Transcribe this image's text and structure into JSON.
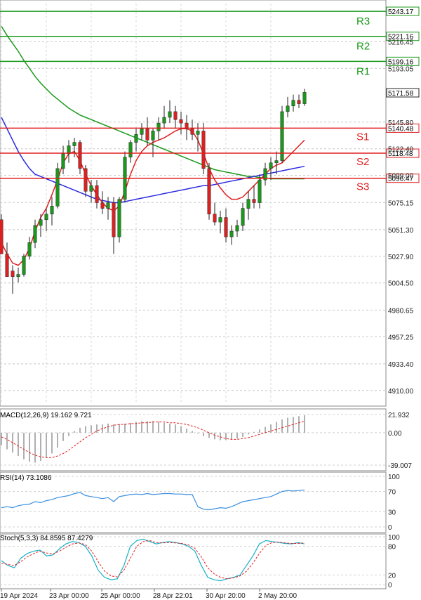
{
  "chart_data": {
    "type": "candlestick",
    "price_axis": {
      "ylim": [
        4900,
        5250
      ],
      "ticks": [
        "5216.45",
        "5193.05",
        "5145.80",
        "5122.40",
        "5099.00",
        "5075.15",
        "5051.30",
        "5027.90",
        "5004.50",
        "4980.65",
        "4957.25",
        "4933.40",
        "4910.00"
      ]
    },
    "time_axis": {
      "labels": [
        "19 Apr 2024",
        "23 Apr 00:00",
        "25 Apr 00:00",
        "28 Apr 22:01",
        "30 Apr 20:00",
        "2 May 20:00"
      ]
    },
    "levels": [
      {
        "name": "R3",
        "value": 5243.17,
        "label": "5243.17",
        "color": "#1a9a1a"
      },
      {
        "name": "R2",
        "value": 5221.16,
        "label": "5221.16",
        "color": "#1a9a1a"
      },
      {
        "name": "R1",
        "value": 5199.16,
        "label": "5199.16",
        "color": "#1a9a1a"
      },
      {
        "name": "S1",
        "value": 5140.48,
        "label": "5140.48",
        "color": "#e02020"
      },
      {
        "name": "S2",
        "value": 5118.48,
        "label": "5118.48",
        "color": "#e02020"
      },
      {
        "name": "S3",
        "value": 5096.47,
        "label": "5096.47",
        "color": "#e02020"
      }
    ],
    "last_price": {
      "value": 5171.58,
      "label": "5171.58"
    },
    "colors": {
      "up": "#1a9a1a",
      "down": "#e02020",
      "wick": "#222222",
      "ma_fast": "#e02020",
      "ma_mid": "#2a2ae0",
      "ma_slow": "#1a9a1a",
      "macd_hist": "#b0b0b0",
      "macd_signal": "#e02020",
      "rsi": "#3a8fe0",
      "stoch_main": "#18b0c8",
      "stoch_signal": "#e02020"
    },
    "candles": [
      [
        5060,
        5065,
        5040,
        5030
      ],
      [
        5030,
        5040,
        5015,
        5010
      ],
      [
        5015,
        5020,
        4995,
        5010
      ],
      [
        5010,
        5018,
        5005,
        5012
      ],
      [
        5012,
        5030,
        5010,
        5028
      ],
      [
        5028,
        5045,
        5025,
        5040
      ],
      [
        5040,
        5060,
        5035,
        5055
      ],
      [
        5055,
        5065,
        5045,
        5060
      ],
      [
        5060,
        5070,
        5050,
        5065
      ],
      [
        5065,
        5080,
        5055,
        5072
      ],
      [
        5072,
        5110,
        5070,
        5105
      ],
      [
        5105,
        5125,
        5100,
        5118
      ],
      [
        5118,
        5130,
        5110,
        5125
      ],
      [
        5125,
        5132,
        5115,
        5128
      ],
      [
        5128,
        5130,
        5100,
        5105
      ],
      [
        5105,
        5108,
        5080,
        5085
      ],
      [
        5085,
        5095,
        5075,
        5090
      ],
      [
        5090,
        5095,
        5070,
        5075
      ],
      [
        5075,
        5085,
        5065,
        5070
      ],
      [
        5070,
        5080,
        5060,
        5075
      ],
      [
        5075,
        5080,
        5030,
        5045
      ],
      [
        5045,
        5080,
        5040,
        5078
      ],
      [
        5078,
        5120,
        5075,
        5115
      ],
      [
        5115,
        5130,
        5110,
        5128
      ],
      [
        5128,
        5140,
        5120,
        5135
      ],
      [
        5135,
        5145,
        5130,
        5140
      ],
      [
        5140,
        5150,
        5125,
        5130
      ],
      [
        5130,
        5140,
        5115,
        5138
      ],
      [
        5138,
        5150,
        5130,
        5145
      ],
      [
        5145,
        5160,
        5140,
        5150
      ],
      [
        5150,
        5165,
        5145,
        5155
      ],
      [
        5155,
        5160,
        5140,
        5148
      ],
      [
        5148,
        5155,
        5135,
        5145
      ],
      [
        5145,
        5152,
        5130,
        5140
      ],
      [
        5140,
        5148,
        5130,
        5135
      ],
      [
        5135,
        5145,
        5120,
        5138
      ],
      [
        5138,
        5145,
        5100,
        5105
      ],
      [
        5105,
        5110,
        5060,
        5065
      ],
      [
        5065,
        5075,
        5055,
        5058
      ],
      [
        5058,
        5068,
        5048,
        5062
      ],
      [
        5062,
        5070,
        5040,
        5045
      ],
      [
        5045,
        5055,
        5038,
        5050
      ],
      [
        5050,
        5060,
        5045,
        5055
      ],
      [
        5055,
        5075,
        5050,
        5070
      ],
      [
        5070,
        5085,
        5060,
        5078
      ],
      [
        5078,
        5090,
        5070,
        5075
      ],
      [
        5075,
        5100,
        5070,
        5095
      ],
      [
        5095,
        5110,
        5090,
        5105
      ],
      [
        5105,
        5115,
        5095,
        5110
      ],
      [
        5110,
        5120,
        5100,
        5112
      ],
      [
        5112,
        5160,
        5110,
        5155
      ],
      [
        5155,
        5168,
        5150,
        5160
      ],
      [
        5160,
        5170,
        5155,
        5165
      ],
      [
        5165,
        5170,
        5158,
        5162
      ],
      [
        5162,
        5175,
        5160,
        5172
      ]
    ],
    "ma_fast": [
      5040,
      5030,
      5022,
      5020,
      5025,
      5035,
      5050,
      5062,
      5070,
      5082,
      5095,
      5110,
      5118,
      5120,
      5112,
      5100,
      5090,
      5082,
      5075,
      5070,
      5068,
      5072,
      5085,
      5100,
      5112,
      5120,
      5125,
      5128,
      5130,
      5132,
      5135,
      5138,
      5140,
      5140,
      5138,
      5130,
      5118,
      5105,
      5095,
      5088,
      5082,
      5078,
      5078,
      5080,
      5085,
      5090,
      5095,
      5100,
      5105,
      5108,
      5110,
      5115,
      5120,
      5125,
      5130
    ],
    "ma_mid": [
      5150,
      5140,
      5130,
      5120,
      5112,
      5105,
      5100,
      5098,
      5096,
      5094,
      5092,
      5090,
      5088,
      5086,
      5084,
      5082,
      5080,
      5078,
      5077,
      5076,
      5075,
      5075,
      5076,
      5077,
      5078,
      5079,
      5080,
      5081,
      5082,
      5083,
      5084,
      5085,
      5086,
      5087,
      5088,
      5089,
      5090,
      5090,
      5091,
      5092,
      5093,
      5094,
      5095,
      5096,
      5097,
      5098,
      5099,
      5100,
      5101,
      5102,
      5103,
      5104,
      5105,
      5106,
      5107
    ],
    "ma_slow": [
      5230,
      5222,
      5215,
      5208,
      5200,
      5193,
      5186,
      5180,
      5175,
      5170,
      5166,
      5162,
      5158,
      5155,
      5152,
      5150,
      5148,
      5146,
      5144,
      5142,
      5140,
      5138,
      5136,
      5134,
      5132,
      5130,
      5128,
      5126,
      5124,
      5122,
      5120,
      5118,
      5116,
      5114,
      5112,
      5110,
      5108,
      5106,
      5104,
      5103,
      5102,
      5101,
      5100,
      5099,
      5098,
      5098,
      5097,
      5097,
      5096,
      5096,
      5096,
      5096,
      5096,
      5096,
      5096
    ],
    "macd": {
      "label": "MACD(12,26,9) 19.162 9.721",
      "ticks": [
        "21.932",
        "0.00",
        "-39.007"
      ],
      "ylim": [
        -39.007,
        21.932
      ],
      "hist": [
        -15,
        -20,
        -24,
        -28,
        -32,
        -35,
        -36,
        -34,
        -30,
        -25,
        -18,
        -10,
        -4,
        2,
        6,
        8,
        9,
        10,
        10,
        11,
        10,
        10,
        11,
        12,
        13,
        14,
        14,
        14,
        13,
        12,
        11,
        10,
        8,
        5,
        2,
        -1,
        -4,
        -6,
        -8,
        -9,
        -9,
        -8,
        -7,
        -5,
        -2,
        1,
        4,
        7,
        10,
        13,
        16,
        18,
        19,
        20,
        21
      ],
      "signal": [
        -5,
        -8,
        -12,
        -16,
        -20,
        -24,
        -27,
        -29,
        -30,
        -30,
        -28,
        -25,
        -21,
        -16,
        -11,
        -6,
        -2,
        2,
        5,
        7,
        9,
        10,
        10,
        11,
        11,
        12,
        12,
        13,
        13,
        13,
        12,
        12,
        11,
        10,
        8,
        6,
        3,
        0,
        -3,
        -5,
        -7,
        -8,
        -8,
        -7,
        -6,
        -4,
        -2,
        0,
        2,
        4,
        6,
        8,
        10,
        12,
        14
      ]
    },
    "rsi": {
      "label": "RSI(14) 73.1086",
      "ticks": [
        "100",
        "70",
        "30",
        "0"
      ],
      "ylim": [
        0,
        100
      ],
      "values": [
        38,
        40,
        38,
        42,
        44,
        45,
        50,
        48,
        52,
        54,
        58,
        60,
        62,
        66,
        68,
        62,
        60,
        58,
        56,
        58,
        50,
        60,
        62,
        64,
        65,
        64,
        66,
        64,
        65,
        66,
        66,
        65,
        65,
        64,
        64,
        40,
        35,
        34,
        36,
        38,
        37,
        40,
        45,
        50,
        52,
        54,
        56,
        58,
        60,
        65,
        70,
        72,
        71,
        72,
        73
      ]
    },
    "stoch": {
      "label": "Stoch(5,3,3) 84.8595 87.4279",
      "ticks": [
        "100",
        "80",
        "20",
        "0"
      ],
      "ylim": [
        0,
        100
      ],
      "main": [
        50,
        40,
        35,
        55,
        65,
        70,
        72,
        60,
        62,
        75,
        85,
        90,
        88,
        80,
        60,
        30,
        15,
        10,
        12,
        40,
        80,
        92,
        95,
        90,
        85,
        88,
        90,
        88,
        85,
        80,
        70,
        40,
        15,
        10,
        8,
        12,
        15,
        20,
        40,
        60,
        85,
        92,
        90,
        88,
        86,
        85,
        88,
        85
      ],
      "signal": [
        45,
        42,
        40,
        48,
        58,
        65,
        70,
        66,
        64,
        70,
        78,
        85,
        87,
        84,
        70,
        48,
        28,
        18,
        16,
        30,
        55,
        80,
        90,
        92,
        88,
        87,
        88,
        87,
        86,
        83,
        76,
        58,
        35,
        22,
        15,
        12,
        14,
        18,
        28,
        45,
        65,
        82,
        88,
        89,
        87,
        86,
        86,
        87
      ]
    }
  }
}
